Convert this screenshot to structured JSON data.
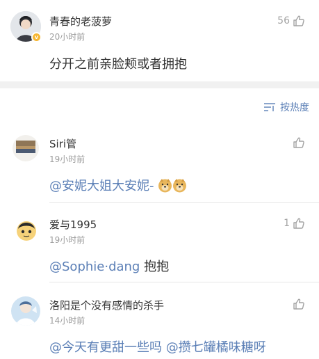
{
  "top_comment": {
    "username": "青春的老菠萝",
    "time": "20小时前",
    "text": "分开之前亲脸颊或者拥抱",
    "likes": "56"
  },
  "sort": {
    "label": "按热度"
  },
  "replies": [
    {
      "username": "Siri管",
      "time": "19小时前",
      "mention": "@安妮大姐大安妮-",
      "emojis": [
        "doge-emoji",
        "doge-emoji"
      ],
      "likes": ""
    },
    {
      "username": "爱与1995",
      "time": "19小时前",
      "mention": "@Sophie·dang",
      "text": " 抱抱",
      "likes": "1"
    },
    {
      "username": "洛阳是个没有感情的杀手",
      "time": "14小时前",
      "mention": "@今天有更甜一些吗 @攒七罐橘味糖呀",
      "likes": ""
    }
  ],
  "colors": {
    "accent": "#5b7fb6",
    "muted": "#9e9e9e",
    "band": "#f1f1f1"
  }
}
